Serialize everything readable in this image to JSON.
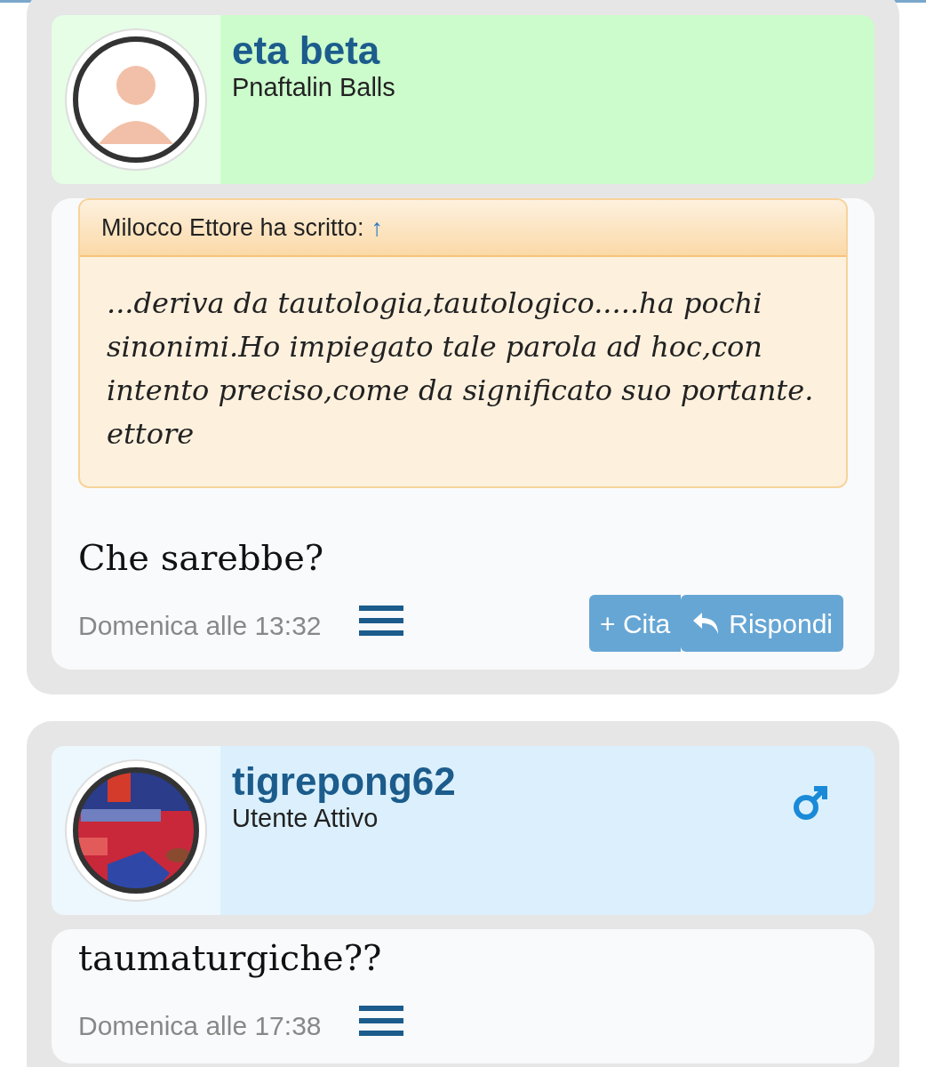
{
  "posts": [
    {
      "author": {
        "name": "eta beta",
        "rank": "Pnaftalin Balls",
        "avatar": {
          "kind": "silhouette"
        },
        "color": "#ccfccc"
      },
      "quote": {
        "header": "Milocco Ettore ha scritto:",
        "arrow": "↑",
        "text": "...deriva da tautologia,tautologico.....ha pochi sinonimi.Ho impiegato tale parola ad hoc,con intento preciso,come da significato suo portante.\nettore"
      },
      "text": "Che sarebbe?",
      "time": "Domenica alle 13:32",
      "buttons": [
        {
          "kind": "quote",
          "label": "+ Cita"
        },
        {
          "kind": "reply",
          "label": "Rispondi"
        }
      ]
    },
    {
      "author": {
        "name": "tigrepong62",
        "rank": "Utente Attivo",
        "color": "#dbf0fc",
        "badge": {
          "kind": "male"
        }
      },
      "text": "taumaturgiche??",
      "time": "Domenica alle 17:38"
    }
  ]
}
